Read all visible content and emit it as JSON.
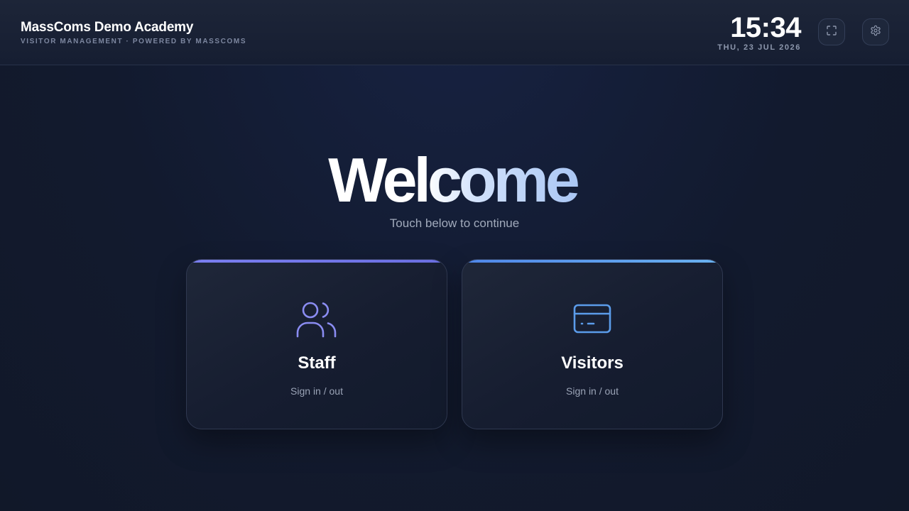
{
  "header": {
    "title": "MassComs Demo Academy",
    "subtitle": "VISITOR MANAGEMENT · POWERED BY MASSCOMS",
    "clock": {
      "time": "15:34",
      "date": "THU, 23 JUL 2026"
    },
    "buttons": [
      {
        "icon": "fullscreen-icon"
      },
      {
        "icon": "gear-icon"
      }
    ]
  },
  "main": {
    "heading": "Welcome",
    "subheading": "Touch below to continue",
    "cards": [
      {
        "icon": "users-icon",
        "title": "Staff",
        "subtitle": "Sign in / out",
        "accent": "#7b7ff0"
      },
      {
        "icon": "credit-card-icon",
        "title": "Visitors",
        "subtitle": "Sign in / out",
        "accent": "#4f86e8"
      }
    ]
  },
  "colors": {
    "background": "#121a2e",
    "header": "#1a2235",
    "staff_accent": "#7b7ff0",
    "visitors_accent": "#5a9ce9"
  }
}
